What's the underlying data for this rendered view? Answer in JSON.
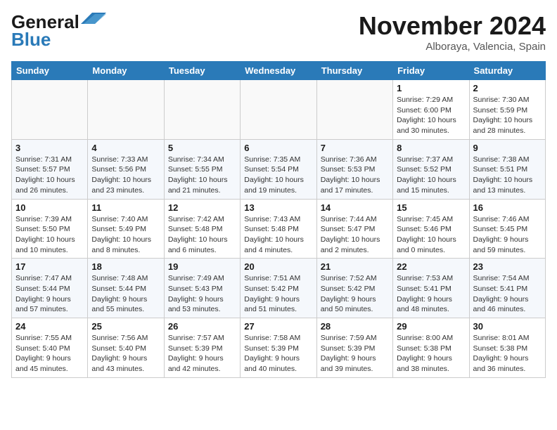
{
  "header": {
    "logo_line1": "General",
    "logo_line2": "Blue",
    "month": "November 2024",
    "location": "Alboraya, Valencia, Spain"
  },
  "weekdays": [
    "Sunday",
    "Monday",
    "Tuesday",
    "Wednesday",
    "Thursday",
    "Friday",
    "Saturday"
  ],
  "weeks": [
    [
      {
        "day": "",
        "info": ""
      },
      {
        "day": "",
        "info": ""
      },
      {
        "day": "",
        "info": ""
      },
      {
        "day": "",
        "info": ""
      },
      {
        "day": "",
        "info": ""
      },
      {
        "day": "1",
        "info": "Sunrise: 7:29 AM\nSunset: 6:00 PM\nDaylight: 10 hours and 30 minutes."
      },
      {
        "day": "2",
        "info": "Sunrise: 7:30 AM\nSunset: 5:59 PM\nDaylight: 10 hours and 28 minutes."
      }
    ],
    [
      {
        "day": "3",
        "info": "Sunrise: 7:31 AM\nSunset: 5:57 PM\nDaylight: 10 hours and 26 minutes."
      },
      {
        "day": "4",
        "info": "Sunrise: 7:33 AM\nSunset: 5:56 PM\nDaylight: 10 hours and 23 minutes."
      },
      {
        "day": "5",
        "info": "Sunrise: 7:34 AM\nSunset: 5:55 PM\nDaylight: 10 hours and 21 minutes."
      },
      {
        "day": "6",
        "info": "Sunrise: 7:35 AM\nSunset: 5:54 PM\nDaylight: 10 hours and 19 minutes."
      },
      {
        "day": "7",
        "info": "Sunrise: 7:36 AM\nSunset: 5:53 PM\nDaylight: 10 hours and 17 minutes."
      },
      {
        "day": "8",
        "info": "Sunrise: 7:37 AM\nSunset: 5:52 PM\nDaylight: 10 hours and 15 minutes."
      },
      {
        "day": "9",
        "info": "Sunrise: 7:38 AM\nSunset: 5:51 PM\nDaylight: 10 hours and 13 minutes."
      }
    ],
    [
      {
        "day": "10",
        "info": "Sunrise: 7:39 AM\nSunset: 5:50 PM\nDaylight: 10 hours and 10 minutes."
      },
      {
        "day": "11",
        "info": "Sunrise: 7:40 AM\nSunset: 5:49 PM\nDaylight: 10 hours and 8 minutes."
      },
      {
        "day": "12",
        "info": "Sunrise: 7:42 AM\nSunset: 5:48 PM\nDaylight: 10 hours and 6 minutes."
      },
      {
        "day": "13",
        "info": "Sunrise: 7:43 AM\nSunset: 5:48 PM\nDaylight: 10 hours and 4 minutes."
      },
      {
        "day": "14",
        "info": "Sunrise: 7:44 AM\nSunset: 5:47 PM\nDaylight: 10 hours and 2 minutes."
      },
      {
        "day": "15",
        "info": "Sunrise: 7:45 AM\nSunset: 5:46 PM\nDaylight: 10 hours and 0 minutes."
      },
      {
        "day": "16",
        "info": "Sunrise: 7:46 AM\nSunset: 5:45 PM\nDaylight: 9 hours and 59 minutes."
      }
    ],
    [
      {
        "day": "17",
        "info": "Sunrise: 7:47 AM\nSunset: 5:44 PM\nDaylight: 9 hours and 57 minutes."
      },
      {
        "day": "18",
        "info": "Sunrise: 7:48 AM\nSunset: 5:44 PM\nDaylight: 9 hours and 55 minutes."
      },
      {
        "day": "19",
        "info": "Sunrise: 7:49 AM\nSunset: 5:43 PM\nDaylight: 9 hours and 53 minutes."
      },
      {
        "day": "20",
        "info": "Sunrise: 7:51 AM\nSunset: 5:42 PM\nDaylight: 9 hours and 51 minutes."
      },
      {
        "day": "21",
        "info": "Sunrise: 7:52 AM\nSunset: 5:42 PM\nDaylight: 9 hours and 50 minutes."
      },
      {
        "day": "22",
        "info": "Sunrise: 7:53 AM\nSunset: 5:41 PM\nDaylight: 9 hours and 48 minutes."
      },
      {
        "day": "23",
        "info": "Sunrise: 7:54 AM\nSunset: 5:41 PM\nDaylight: 9 hours and 46 minutes."
      }
    ],
    [
      {
        "day": "24",
        "info": "Sunrise: 7:55 AM\nSunset: 5:40 PM\nDaylight: 9 hours and 45 minutes."
      },
      {
        "day": "25",
        "info": "Sunrise: 7:56 AM\nSunset: 5:40 PM\nDaylight: 9 hours and 43 minutes."
      },
      {
        "day": "26",
        "info": "Sunrise: 7:57 AM\nSunset: 5:39 PM\nDaylight: 9 hours and 42 minutes."
      },
      {
        "day": "27",
        "info": "Sunrise: 7:58 AM\nSunset: 5:39 PM\nDaylight: 9 hours and 40 minutes."
      },
      {
        "day": "28",
        "info": "Sunrise: 7:59 AM\nSunset: 5:39 PM\nDaylight: 9 hours and 39 minutes."
      },
      {
        "day": "29",
        "info": "Sunrise: 8:00 AM\nSunset: 5:38 PM\nDaylight: 9 hours and 38 minutes."
      },
      {
        "day": "30",
        "info": "Sunrise: 8:01 AM\nSunset: 5:38 PM\nDaylight: 9 hours and 36 minutes."
      }
    ]
  ]
}
